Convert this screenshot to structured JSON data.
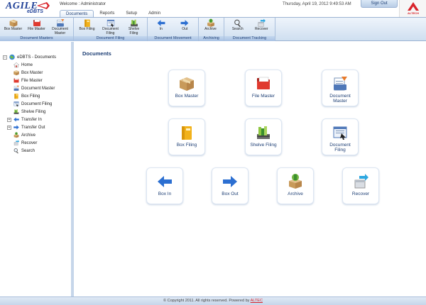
{
  "header": {
    "logo_text": "AGILE",
    "logo_sub": "eDBTS",
    "welcome_label": "Welcome :",
    "user_name": "Administrator",
    "datetime": "Thursday, April 19, 2012   9:49:53 AM",
    "sign_out": "Sign Out",
    "corp_logo_text": "ALTECH"
  },
  "menu": [
    "Documents",
    "Reports",
    "Setup",
    "Admin"
  ],
  "ribbon": {
    "groups": [
      {
        "title": "Document Masters",
        "buttons": [
          {
            "label": "Box Master",
            "icon": "box-icon"
          },
          {
            "label": "File Master",
            "icon": "file-folder-icon"
          },
          {
            "label": "Document Master",
            "icon": "document-master-icon"
          }
        ]
      },
      {
        "title": "Document Filing",
        "buttons": [
          {
            "label": "Box Filing",
            "icon": "box-filing-icon"
          },
          {
            "label": "Document Filing",
            "icon": "document-filing-icon"
          },
          {
            "label": "Shelve Filing",
            "icon": "shelve-filing-icon"
          }
        ]
      },
      {
        "title": "Document Movement",
        "buttons": [
          {
            "label": "In",
            "icon": "arrow-left-icon"
          },
          {
            "label": "Out",
            "icon": "arrow-right-icon"
          }
        ]
      },
      {
        "title": "Archiving",
        "buttons": [
          {
            "label": "Archive",
            "icon": "archive-icon"
          }
        ]
      },
      {
        "title": "Document Tracking",
        "buttons": [
          {
            "label": "Search",
            "icon": "search-icon"
          },
          {
            "label": "Recover",
            "icon": "recover-icon"
          }
        ]
      }
    ]
  },
  "sidebar": {
    "root": "eDBTS - Documents",
    "items": [
      {
        "label": "Home",
        "icon": "home-icon"
      },
      {
        "label": "Box Master",
        "icon": "box-icon"
      },
      {
        "label": "File Master",
        "icon": "file-folder-icon"
      },
      {
        "label": "Document Master",
        "icon": "document-master-icon"
      },
      {
        "label": "Box Filing",
        "icon": "box-filing-icon"
      },
      {
        "label": "Document Filing",
        "icon": "document-filing-icon"
      },
      {
        "label": "Shelve Filing",
        "icon": "shelve-filing-icon"
      },
      {
        "label": "Transfer In",
        "icon": "arrow-left-icon"
      },
      {
        "label": "Transfer Out",
        "icon": "arrow-right-icon"
      },
      {
        "label": "Archive",
        "icon": "archive-icon"
      },
      {
        "label": "Recover",
        "icon": "recover-icon"
      },
      {
        "label": "Search",
        "icon": "search-icon"
      }
    ]
  },
  "main": {
    "title": "Documents",
    "tiles": [
      {
        "label": "Box Master",
        "icon": "box-icon"
      },
      {
        "label": "File Master",
        "icon": "file-folder-icon"
      },
      {
        "label": "Document Master",
        "icon": "document-master-icon"
      },
      {
        "label": "Box Filing",
        "icon": "box-filing-icon"
      },
      {
        "label": "Shelve Filing",
        "icon": "shelve-filing-icon"
      },
      {
        "label": "Document Filing",
        "icon": "document-filing-icon"
      },
      {
        "label": "Box In",
        "icon": "arrow-left-icon"
      },
      {
        "label": "Box Out",
        "icon": "arrow-right-icon"
      },
      {
        "label": "Archive",
        "icon": "archive-icon"
      },
      {
        "label": "Recover",
        "icon": "recover-icon"
      }
    ]
  },
  "footer": {
    "text": "© Copyright 2011. All rights reserved. Powered by",
    "link": "ALTEC"
  },
  "colors": {
    "accent": "#1e3f75",
    "ribbon": "#cfdff0",
    "brand_red": "#d8232a"
  }
}
